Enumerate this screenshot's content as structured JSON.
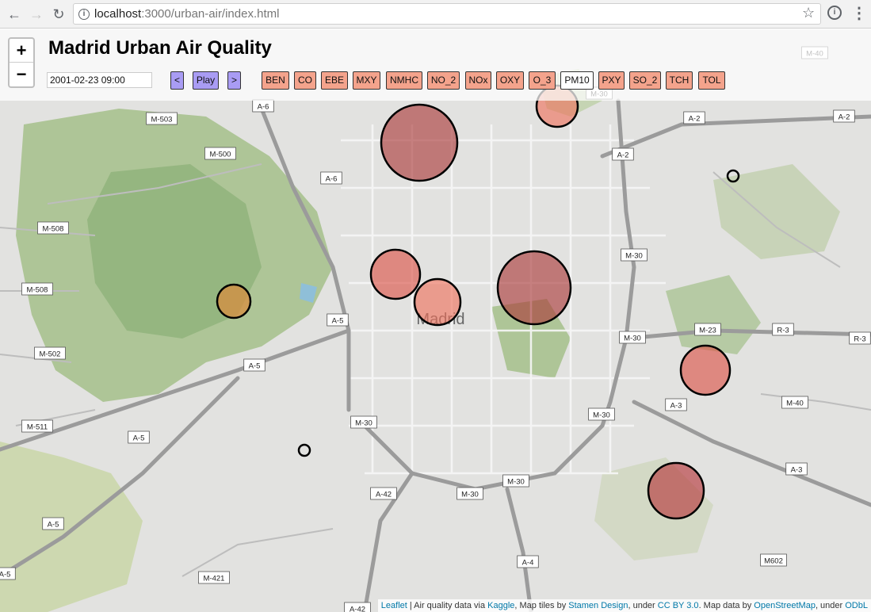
{
  "browser": {
    "url_host": "localhost",
    "url_path": ":3000/urban-air/index.html"
  },
  "controls": {
    "title": "Madrid Urban Air Quality",
    "datetime_value": "2001-02-23 09:00",
    "prev_label": "<",
    "play_label": "Play",
    "next_label": ">",
    "zoom_in_label": "+",
    "zoom_out_label": "−"
  },
  "pollutants": [
    {
      "label": "BEN",
      "active": false
    },
    {
      "label": "CO",
      "active": false
    },
    {
      "label": "EBE",
      "active": false
    },
    {
      "label": "MXY",
      "active": false
    },
    {
      "label": "NMHC",
      "active": false
    },
    {
      "label": "NO_2",
      "active": false
    },
    {
      "label": "NOx",
      "active": false
    },
    {
      "label": "OXY",
      "active": false
    },
    {
      "label": "O_3",
      "active": false
    },
    {
      "label": "PM10",
      "active": true
    },
    {
      "label": "PXY",
      "active": false
    },
    {
      "label": "SO_2",
      "active": false
    },
    {
      "label": "TCH",
      "active": false
    },
    {
      "label": "TOL",
      "active": false
    }
  ],
  "map": {
    "city_label": "Madrid",
    "road_labels": [
      "M-40",
      "A-6",
      "M-503",
      "M-30",
      "A-2",
      "A-2",
      "M-500",
      "A-2",
      "A-6",
      "M-508",
      "M-30",
      "M-508",
      "A-5",
      "M-23",
      "R-3",
      "M-30",
      "M-502",
      "A-5",
      "R-3",
      "A-3",
      "M-40",
      "M-30",
      "M-511",
      "M-30",
      "A-5",
      "A-3",
      "A-42",
      "M-30",
      "M-30",
      "A-5",
      "A-4",
      "M602",
      "A-5",
      "M-421",
      "A-42"
    ],
    "colors": {
      "circle_red": "#c0504d",
      "circle_light": "#ef6f5a",
      "circle_orange": "#d98a3c"
    }
  },
  "attribution": {
    "leaflet": "Leaflet",
    "text1": " | Air quality data via ",
    "kaggle": "Kaggle",
    "text2": ", Map tiles by ",
    "stamen": "Stamen Design",
    "text3": ", under ",
    "ccby": "CC BY 3.0",
    "text4": ". Map data by ",
    "osm": "OpenStreetMap",
    "text5": ", under ",
    "odbl": "ODbL"
  }
}
